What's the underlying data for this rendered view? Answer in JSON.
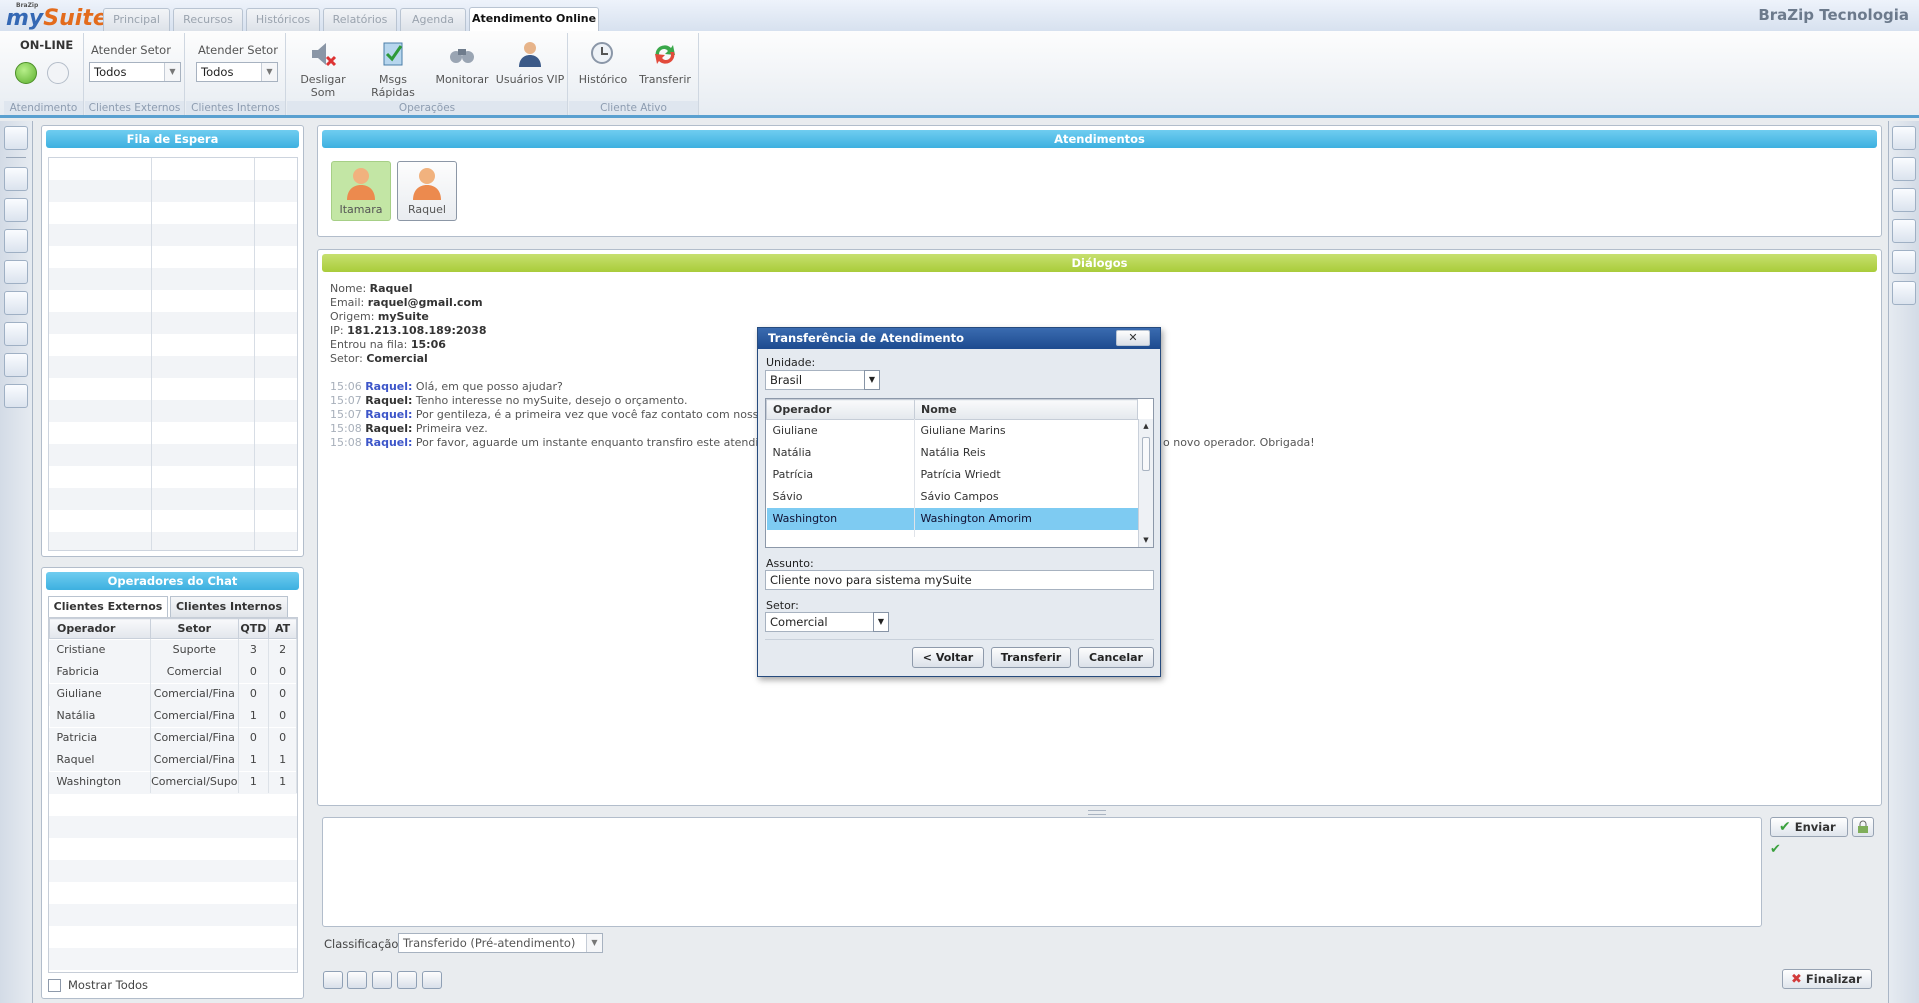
{
  "app": {
    "logo_prefix": "my",
    "logo_suffix": "Suite",
    "logo_small": "BraZip",
    "company": "BraZip Tecnologia"
  },
  "tabs": [
    {
      "label": "Principal"
    },
    {
      "label": "Recursos"
    },
    {
      "label": "Históricos"
    },
    {
      "label": "Relatórios"
    },
    {
      "label": "Agenda"
    },
    {
      "label": "Atendimento Online"
    }
  ],
  "ribbon": {
    "status_label": "ON-LINE",
    "group_atendimento": "Atendimento",
    "setor_ext_label": "Atender Setor",
    "setor_ext_value": "Todos",
    "group_clientes_ext": "Clientes Externos",
    "setor_int_label": "Atender Setor",
    "setor_int_value": "Todos",
    "group_clientes_int": "Clientes Internos",
    "ops": [
      {
        "label": "Desligar Som",
        "icon": "mute-speaker-icon"
      },
      {
        "label": "Msgs Rápidas",
        "icon": "quick-messages-icon"
      },
      {
        "label": "Monitorar",
        "icon": "binoculars-icon"
      },
      {
        "label": "Usuários VIP",
        "icon": "vip-user-icon"
      }
    ],
    "group_operacoes": "Operações",
    "active": [
      {
        "label": "Histórico",
        "icon": "history-icon"
      },
      {
        "label": "Transferir",
        "icon": "transfer-icon"
      }
    ],
    "group_cliente_ativo": "Cliente Ativo"
  },
  "queue": {
    "title": "Fila de Espera"
  },
  "operators": {
    "title": "Operadores do Chat",
    "tab_ext": "Clientes Externos",
    "tab_int": "Clientes Internos",
    "headers": [
      "Operador",
      "Setor",
      "QTD",
      "AT"
    ],
    "rows": [
      [
        "Cristiane",
        "Suporte",
        "3",
        "2"
      ],
      [
        "Fabricia",
        "Comercial",
        "0",
        "0"
      ],
      [
        "Giuliane",
        "Comercial/Fina",
        "0",
        "0"
      ],
      [
        "Natália",
        "Comercial/Fina",
        "1",
        "0"
      ],
      [
        "Patricia",
        "Comercial/Fina",
        "0",
        "0"
      ],
      [
        "Raquel",
        "Comercial/Fina",
        "1",
        "1"
      ],
      [
        "Washington",
        "Comercial/Supo",
        "1",
        "1"
      ]
    ],
    "show_all": "Mostrar Todos"
  },
  "atendimentos": {
    "title": "Atendimentos",
    "agents": [
      {
        "name": "Itamara"
      },
      {
        "name": "Raquel"
      }
    ]
  },
  "dialogos": {
    "title": "Diálogos",
    "info": [
      {
        "k": "Nome: ",
        "v": "Raquel"
      },
      {
        "k": "Email: ",
        "v": "raquel@gmail.com"
      },
      {
        "k": "Origem: ",
        "v": "mySuite"
      },
      {
        "k": "IP: ",
        "v": "181.213.108.189:2038"
      },
      {
        "k": "Entrou na fila: ",
        "v": "15:06"
      },
      {
        "k": "Setor: ",
        "v": "Comercial"
      }
    ],
    "messages": [
      {
        "time": "15:06",
        "who": "Raquel:",
        "text": " Olá, em que posso ajudar?",
        "who_color": "#3d56c9"
      },
      {
        "time": "15:07",
        "who": "Raquel:",
        "text": " Tenho interesse no mySuite, desejo o orçamento.",
        "who_color": "#333333"
      },
      {
        "time": "15:07",
        "who": "Raquel:",
        "text": " Por gentileza, é a primeira vez que você faz contato com nossa emp",
        "who_color": "#3d56c9"
      },
      {
        "time": "15:08",
        "who": "Raquel:",
        "text": " Primeira vez.",
        "who_color": "#333333"
      },
      {
        "time": "15:08",
        "who": "Raquel:",
        "text": " Por favor, aguarde um instante enquanto transfiro este atendiment",
        "who_color": "#3d56c9"
      }
    ],
    "tail_text": "o novo operador. Obrigada!"
  },
  "compose": {
    "send": "Enviar",
    "classificacao_label": "Classificação:",
    "classificacao_value": "Transferido (Pré-atendimento)",
    "finalize": "Finalizar"
  },
  "modal": {
    "title": "Transferência de Atendimento",
    "close": "✕",
    "unidade_label": "Unidade:",
    "unidade_value": "Brasil",
    "headers": [
      "Operador",
      "Nome"
    ],
    "rows": [
      {
        "op": "Giuliane",
        "nome": "Giuliane Marins"
      },
      {
        "op": "Natália",
        "nome": "Natália Reis"
      },
      {
        "op": "Patrícia",
        "nome": "Patrícia Wriedt"
      },
      {
        "op": "Sávio",
        "nome": "Sávio Campos"
      },
      {
        "op": "Washington",
        "nome": "Washington Amorim"
      }
    ],
    "selected_index": 4,
    "assunto_label": "Assunto:",
    "assunto_value": "Cliente novo para sistema mySuite",
    "setor_label": "Setor:",
    "setor_value": "Comercial",
    "back": "< Voltar",
    "transfer": "Transferir",
    "cancel": "Cancelar"
  },
  "colors": {
    "accent_blue": "#3db0e0",
    "accent_green": "#a9cc3a",
    "selection": "#7ecbf2",
    "title_bar": "#1d4b8f"
  }
}
